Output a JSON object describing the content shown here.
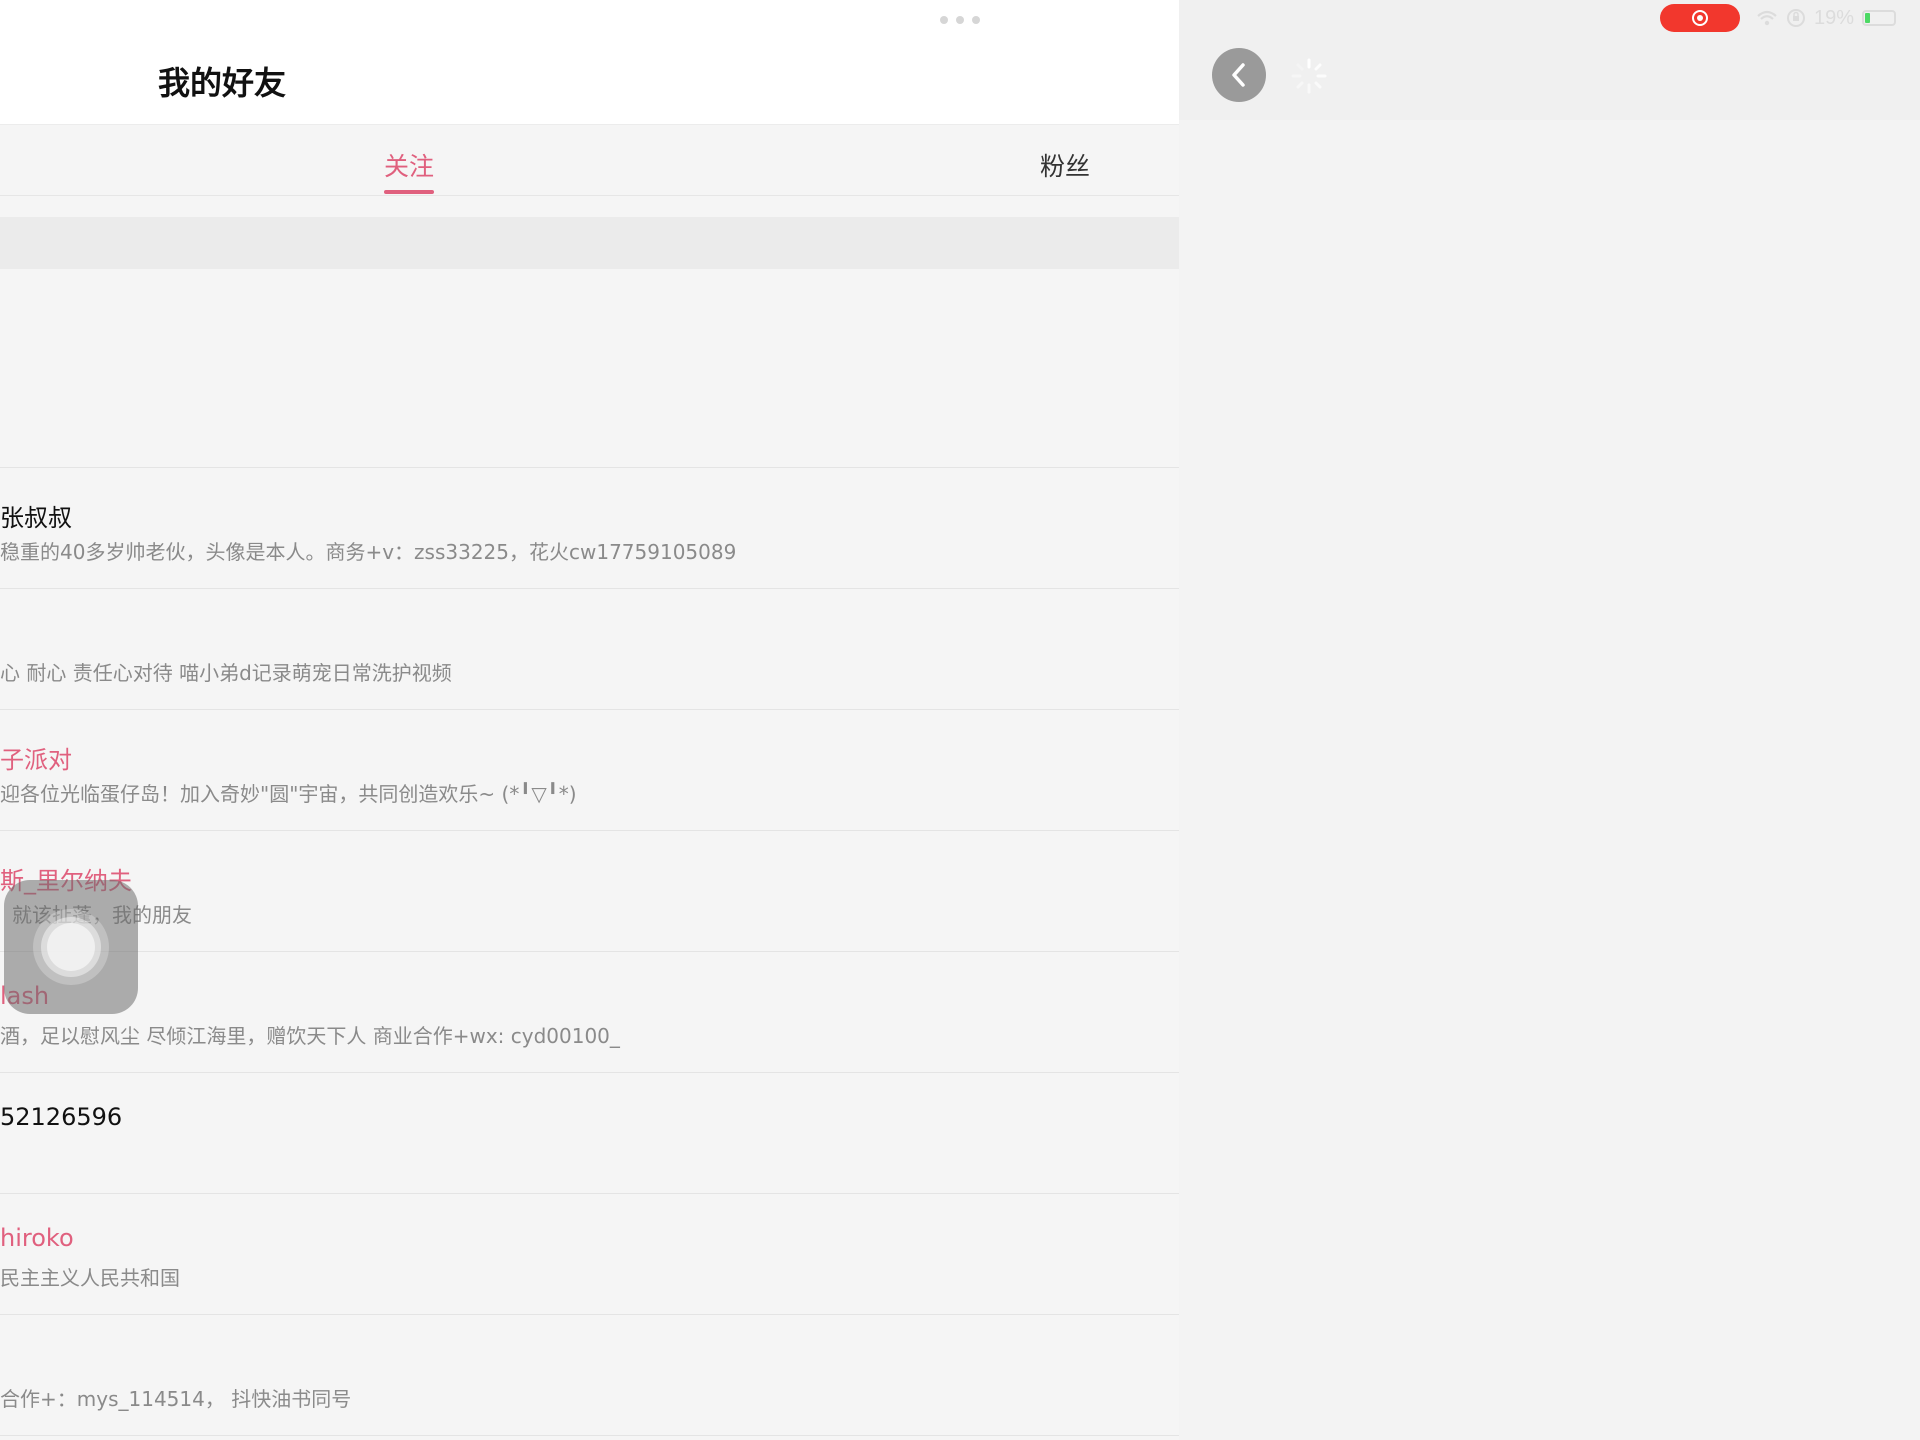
{
  "header": {
    "title": "我的好友"
  },
  "tabs": [
    {
      "label": "关注",
      "active": true
    },
    {
      "label": "粉丝",
      "active": false
    }
  ],
  "friends": [
    {
      "name": "张叔叔",
      "desc": "稳重的40多岁帅老伙，头像是本人。商务+v：zss33225，花火cw17759105089"
    },
    {
      "name": "",
      "desc": "心 耐心 责任心对待 喵小弟d记录萌宠日常洗护视频"
    },
    {
      "name": "子派对",
      "desc": "迎各位光临蛋仔岛！加入奇妙\"圆\"宇宙，共同创造欢乐~ (*╹▽╹*)"
    },
    {
      "name": "斯_里尔纳夫",
      "desc": "就该扯蓬，我的朋友"
    },
    {
      "name": "lash",
      "desc": "酒，足以慰风尘 尽倾江海里，赠饮天下人 商业合作+wx: cyd00100_"
    },
    {
      "name": "52126596",
      "desc": ""
    },
    {
      "name": "hiroko",
      "desc": "民主主义人民共和国"
    },
    {
      "name": "",
      "desc": "合作+：mys_114514， 抖快油书同号"
    }
  ],
  "status_bar": {
    "battery_percent": "19%",
    "battery_level": 0.19
  },
  "colors": {
    "accent": "#e0607e",
    "recording": "#f2372d",
    "battery_fill": "#4cd964"
  },
  "icons": {
    "back": "chevron-left-icon",
    "loading": "spinner-icon",
    "recording": "screen-record-icon",
    "wifi": "wifi-icon",
    "orientation_lock": "orientation-lock-icon",
    "battery": "battery-icon",
    "assistive_touch": "assistive-touch-icon"
  }
}
